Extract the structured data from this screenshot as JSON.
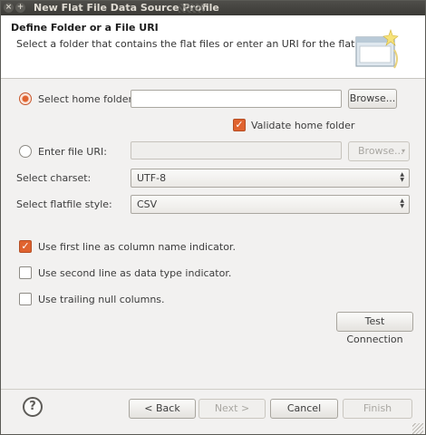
{
  "window": {
    "title": "New Flat File Data Source Profile"
  },
  "banner": {
    "title": "Define Folder or a File URI",
    "description": "Select a folder that contains the flat files or enter an URI for the flat file."
  },
  "home_folder": {
    "radio_label": "Select home folder:",
    "value": "",
    "browse_label": "Browse...",
    "validate_label": "Validate home folder"
  },
  "file_uri": {
    "radio_label": "Enter file URI:",
    "value": "",
    "browse_label": "Browse..."
  },
  "charset": {
    "label": "Select charset:",
    "value": "UTF-8"
  },
  "flatfile_style": {
    "label": "Select flatfile style:",
    "value": "CSV"
  },
  "options": {
    "first_line": "Use first line as column name indicator.",
    "second_line": "Use second line as data type indicator.",
    "trailing_null": "Use trailing null columns."
  },
  "test_connection_label": "Test Connection",
  "footer": {
    "help": "?",
    "back": "< Back",
    "next": "Next >",
    "cancel": "Cancel",
    "finish": "Finish"
  }
}
